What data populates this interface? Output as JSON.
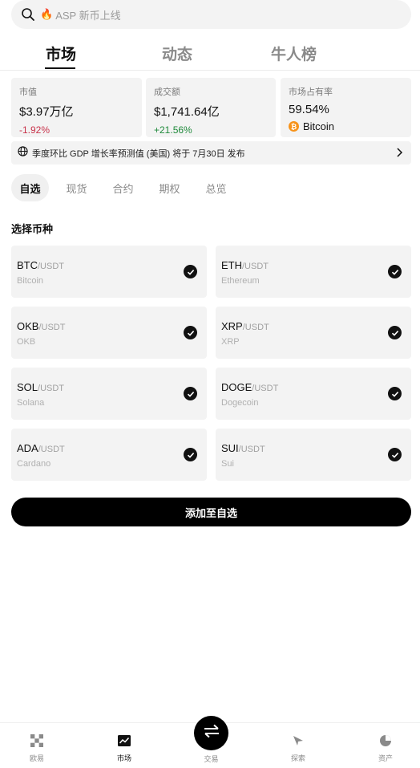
{
  "search": {
    "hot_icon": "fire-icon",
    "placeholder": "ASP 新币上线"
  },
  "tabs": [
    {
      "label": "市场",
      "active": true
    },
    {
      "label": "动态",
      "active": false
    },
    {
      "label": "牛人榜",
      "active": false
    }
  ],
  "stats": {
    "market_cap": {
      "label": "市值",
      "value": "$3.97万亿",
      "change": "-1.92%"
    },
    "volume": {
      "label": "成交额",
      "value": "$1,741.64亿",
      "change": "+21.56%"
    },
    "dominance": {
      "label": "市场占有率",
      "value": "59.54%",
      "coin": "Bitcoin",
      "coin_symbol": "₿"
    }
  },
  "notice": {
    "text": "季度环比 GDP 增长率预测值 (美国) 将于 7月30日 发布"
  },
  "subtabs": [
    {
      "label": "自选",
      "active": true
    },
    {
      "label": "现货",
      "active": false
    },
    {
      "label": "合约",
      "active": false
    },
    {
      "label": "期权",
      "active": false
    },
    {
      "label": "总览",
      "active": false
    }
  ],
  "section_title": "选择币种",
  "coins": [
    {
      "symbol": "BTC",
      "quote": "/USDT",
      "name": "Bitcoin",
      "selected": true
    },
    {
      "symbol": "ETH",
      "quote": "/USDT",
      "name": "Ethereum",
      "selected": true
    },
    {
      "symbol": "OKB",
      "quote": "/USDT",
      "name": "OKB",
      "selected": true
    },
    {
      "symbol": "XRP",
      "quote": "/USDT",
      "name": "XRP",
      "selected": true
    },
    {
      "symbol": "SOL",
      "quote": "/USDT",
      "name": "Solana",
      "selected": true
    },
    {
      "symbol": "DOGE",
      "quote": "/USDT",
      "name": "Dogecoin",
      "selected": true
    },
    {
      "symbol": "ADA",
      "quote": "/USDT",
      "name": "Cardano",
      "selected": true
    },
    {
      "symbol": "SUI",
      "quote": "/USDT",
      "name": "Sui",
      "selected": true
    }
  ],
  "add_button": "添加至自选",
  "bottom_nav": [
    {
      "label": "欧易",
      "icon": "okx-logo-icon",
      "active": false
    },
    {
      "label": "市场",
      "icon": "market-chart-icon",
      "active": true
    },
    {
      "label": "交易",
      "icon": "swap-arrows-icon",
      "active": false
    },
    {
      "label": "探索",
      "icon": "compass-icon",
      "active": false
    },
    {
      "label": "资产",
      "icon": "pie-chart-icon",
      "active": false
    }
  ],
  "colors": {
    "negative": "#c8324a",
    "positive": "#1f8a3b",
    "bitcoin": "#f7931a",
    "accent": "#000000"
  }
}
